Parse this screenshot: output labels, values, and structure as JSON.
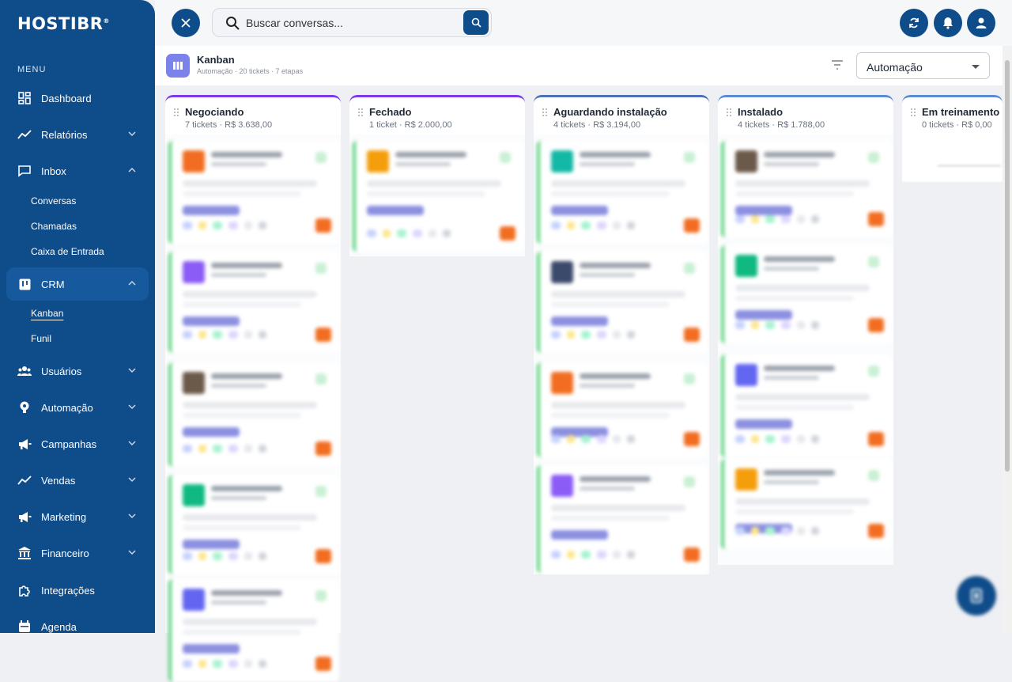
{
  "brand": {
    "name": "HOSTIBR",
    "mark": "®"
  },
  "sidebar": {
    "menu_title": "MENU",
    "items": [
      {
        "label": "Dashboard"
      },
      {
        "label": "Relatórios"
      },
      {
        "label": "Inbox"
      },
      {
        "label": "CRM"
      },
      {
        "label": "Usuários"
      },
      {
        "label": "Automação"
      },
      {
        "label": "Campanhas"
      },
      {
        "label": "Vendas"
      },
      {
        "label": "Marketing"
      },
      {
        "label": "Financeiro"
      },
      {
        "label": "Integrações"
      },
      {
        "label": "Agenda"
      }
    ],
    "inbox_sub": [
      "Conversas",
      "Chamadas",
      "Caixa de Entrada"
    ],
    "crm_sub": [
      "Kanban",
      "Funil"
    ]
  },
  "search": {
    "placeholder": "Buscar conversas..."
  },
  "page": {
    "title": "Kanban",
    "subtitle": "Automação · 20 tickets · 7 etapas",
    "pipeline": "Automação"
  },
  "columns": [
    {
      "title": "Negociando",
      "meta": "7 tickets · R$ 3.638,00",
      "color": "#7c3aed"
    },
    {
      "title": "Fechado",
      "meta": "1 ticket · R$ 2.000,00",
      "color": "#7c3aed"
    },
    {
      "title": "Aguardando instalação",
      "meta": "4 tickets · R$ 3.194,00",
      "color": "#4f6fb8"
    },
    {
      "title": "Instalado",
      "meta": "4 tickets · R$ 1.788,00",
      "color": "#5b8bd6"
    },
    {
      "title": "Em treinamento",
      "meta": "0 tickets · R$ 0,00",
      "color": "#5b8bd6"
    }
  ],
  "colors": {
    "sidebar": "#0f4c8a",
    "accent_green": "#5bd27d",
    "orange": "#f26d21"
  }
}
